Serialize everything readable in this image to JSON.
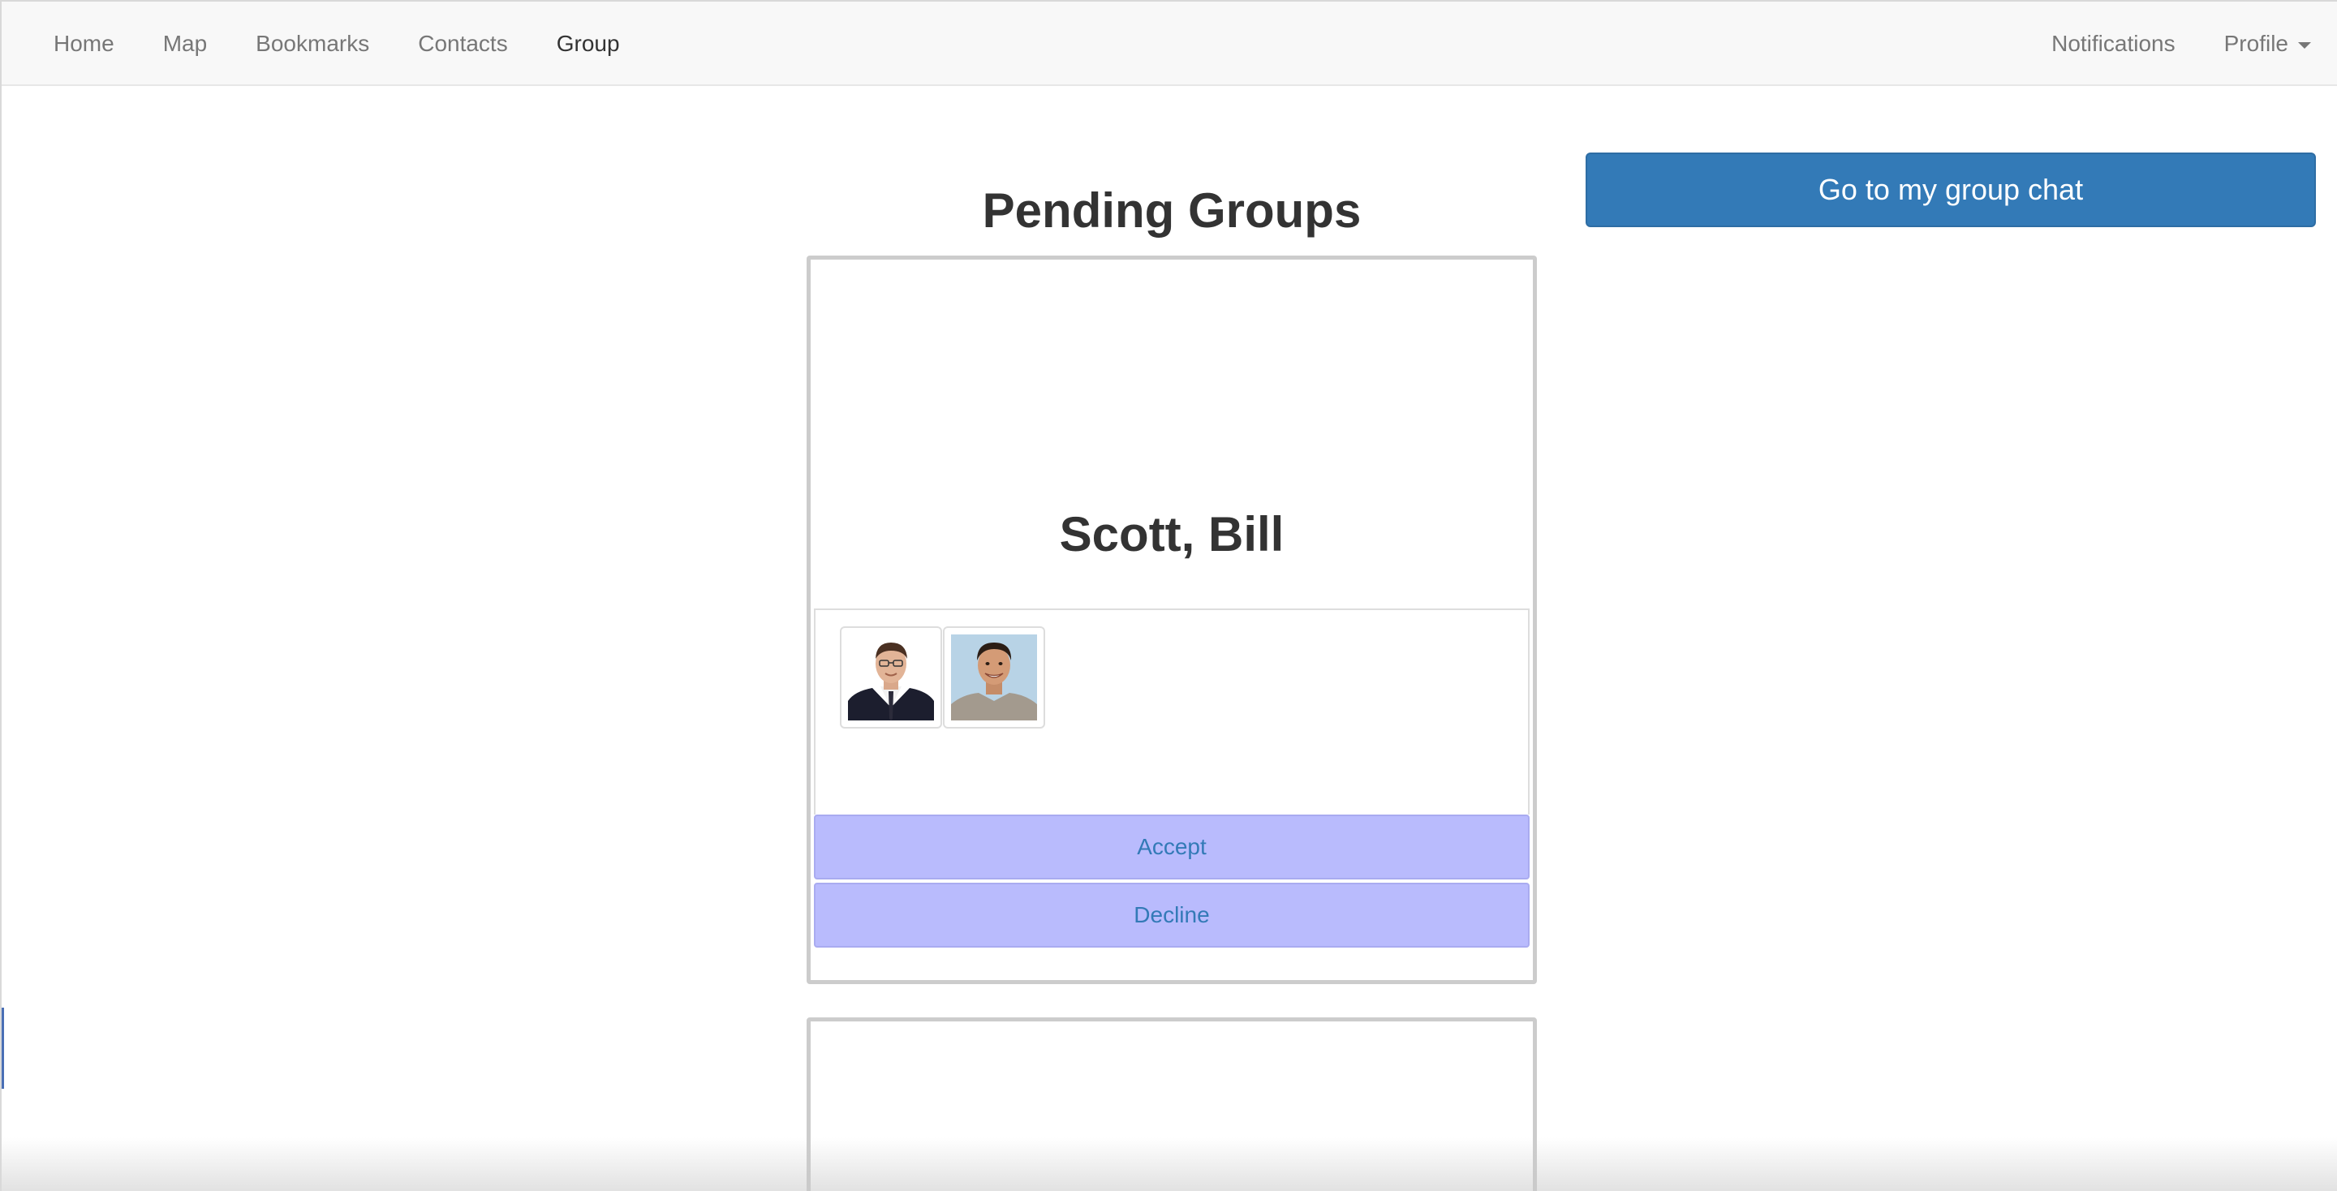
{
  "nav": {
    "left_items": [
      {
        "label": "Home"
      },
      {
        "label": "Map"
      },
      {
        "label": "Bookmarks"
      },
      {
        "label": "Contacts"
      },
      {
        "label": "Group"
      }
    ],
    "active": "Group",
    "right_items": {
      "notifications": "Notifications",
      "profile": "Profile"
    }
  },
  "main": {
    "title": "Pending Groups",
    "chat_button": "Go to my group chat",
    "groups": [
      {
        "name": "Scott, Bill",
        "members": [
          {
            "icon": "person-in-suit-photo"
          },
          {
            "icon": "person-smiling-photo"
          }
        ],
        "accept_label": "Accept",
        "decline_label": "Decline"
      }
    ]
  },
  "colors": {
    "primary": "#337ab7",
    "action_button_bg": "#b9bbfd",
    "navbar_bg": "#f8f8f8"
  }
}
